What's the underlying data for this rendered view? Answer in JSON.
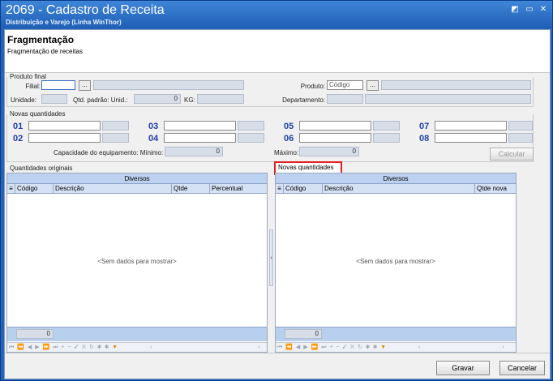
{
  "window": {
    "title": "2069 - Cadastro de Receita",
    "subtitle": "Distribuição e Varejo (Linha WinThor)",
    "buttons": [
      "◩",
      "▭",
      "✕"
    ]
  },
  "header": {
    "title": "Fragmentação",
    "subtitle": "Fragmentação de receitas"
  },
  "produto_final": {
    "group_label": "Produto final",
    "filial_label": "Filial:",
    "filial_value": "",
    "unidade_label": "Unidade:",
    "qtd_padrao_label": "Qtd. padrão: Unid.:",
    "qtd_padrao_value": "0",
    "kg_label": "KG:",
    "produto_label": "Produto:",
    "produto_placeholder": "Código",
    "departamento_label": "Departamento:",
    "dots_label": "..."
  },
  "novas_quantidades_group": {
    "group_label": "Novas quantidades",
    "slots": [
      "01",
      "02",
      "03",
      "04",
      "05",
      "06",
      "07",
      "08"
    ],
    "capacidade_label": "Capacidade do equipamento: Mínimo:",
    "minimo_value": "0",
    "maximo_label": "Máximo:",
    "maximo_value": "0",
    "calcular_label": "Calcular"
  },
  "left_grid": {
    "section_label": "Quantidades originais",
    "band_label": "Diversos",
    "columns": [
      "Código",
      "Descrição",
      "Qtde",
      "Percentual"
    ],
    "empty_text": "<Sem dados para mostrar>",
    "footer_value": "0"
  },
  "right_grid": {
    "section_label": "Novas quantidades",
    "band_label": "Diversos",
    "columns": [
      "Código",
      "Descrição",
      "Qtde nova"
    ],
    "empty_text": "<Sem dados para mostrar>",
    "footer_value": "0"
  },
  "footer": {
    "gravar_label": "Gravar",
    "cancelar_label": "Cancelar"
  },
  "colors": {
    "titlebar": "#2563b8",
    "number_blue": "#1f3fa8",
    "highlight_red": "#e02020"
  }
}
